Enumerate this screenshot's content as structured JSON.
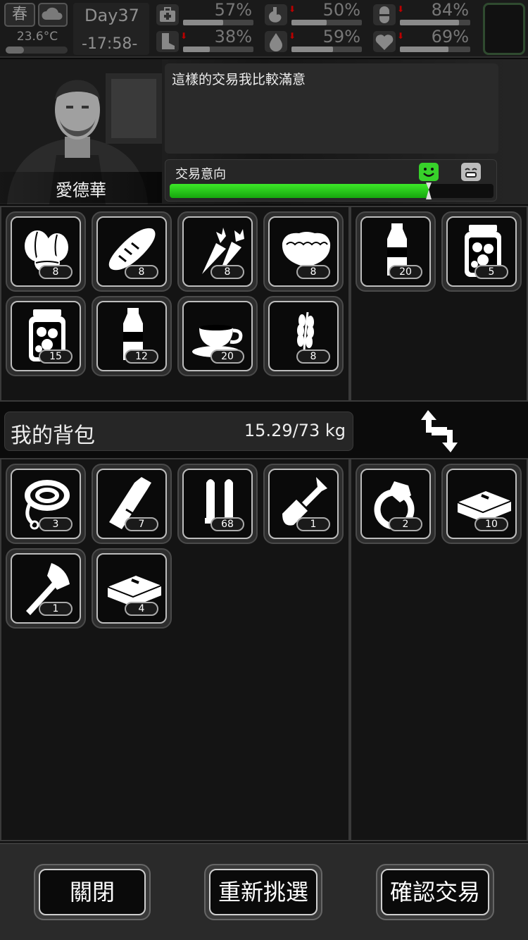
{
  "status": {
    "season": "春",
    "weather_icon": "cloud-icon",
    "temperature": "23.6°C",
    "temperature_level": 0.3,
    "day": "Day37",
    "time": "-17:58-",
    "stats": [
      {
        "name": "health",
        "icon": "medkit-icon",
        "percent": "57%",
        "level": 0.57,
        "down": false
      },
      {
        "name": "hunger",
        "icon": "stomach-icon",
        "percent": "50%",
        "level": 0.5,
        "down": true
      },
      {
        "name": "drug",
        "icon": "pill-icon",
        "percent": "84%",
        "level": 0.84,
        "down": true
      },
      {
        "name": "stamina",
        "icon": "boot-icon",
        "percent": "38%",
        "level": 0.38,
        "down": true
      },
      {
        "name": "thirst",
        "icon": "water-drop-icon",
        "percent": "59%",
        "level": 0.59,
        "down": true
      },
      {
        "name": "mood",
        "icon": "heart-icon",
        "percent": "69%",
        "level": 0.69,
        "down": true
      }
    ]
  },
  "trader": {
    "name": "愛德華",
    "dialog": "這樣的交易我比較滿意",
    "intent_label": "交易意向",
    "intent_level": 0.8
  },
  "trader_items": [
    {
      "icon": "coffee-beans-icon",
      "qty": "8"
    },
    {
      "icon": "bread-icon",
      "qty": "8"
    },
    {
      "icon": "carrot-icon",
      "qty": "8"
    },
    {
      "icon": "meat-icon",
      "qty": "8"
    },
    {
      "icon": "pickle-jar-icon",
      "qty": "15"
    },
    {
      "icon": "water-bottle-icon",
      "qty": "12"
    },
    {
      "icon": "coffee-cup-icon",
      "qty": "20"
    },
    {
      "icon": "wheat-icon",
      "qty": "8"
    }
  ],
  "trader_offer": [
    {
      "icon": "water-bottle-icon",
      "qty": "20"
    },
    {
      "icon": "pickle-jar-icon",
      "qty": "5"
    }
  ],
  "backpack": {
    "title": "我的背包",
    "weight": "15.29/73 kg"
  },
  "my_items": [
    {
      "icon": "rope-icon",
      "qty": "3"
    },
    {
      "icon": "glass-bottle-icon",
      "qty": "7"
    },
    {
      "icon": "bullets-icon",
      "qty": "68"
    },
    {
      "icon": "shovel-icon",
      "qty": "1"
    },
    {
      "icon": "axe-icon",
      "qty": "1"
    },
    {
      "icon": "cash-bundle-icon",
      "qty": "4"
    }
  ],
  "my_offer": [
    {
      "icon": "ring-icon",
      "qty": "2"
    },
    {
      "icon": "cash-bundle-icon",
      "qty": "10"
    }
  ],
  "buttons": {
    "close": "關閉",
    "reset": "重新挑選",
    "confirm": "確認交易"
  },
  "colors": {
    "intent_green": "#37d12a",
    "stat_down_arrow": "#bb0000"
  }
}
